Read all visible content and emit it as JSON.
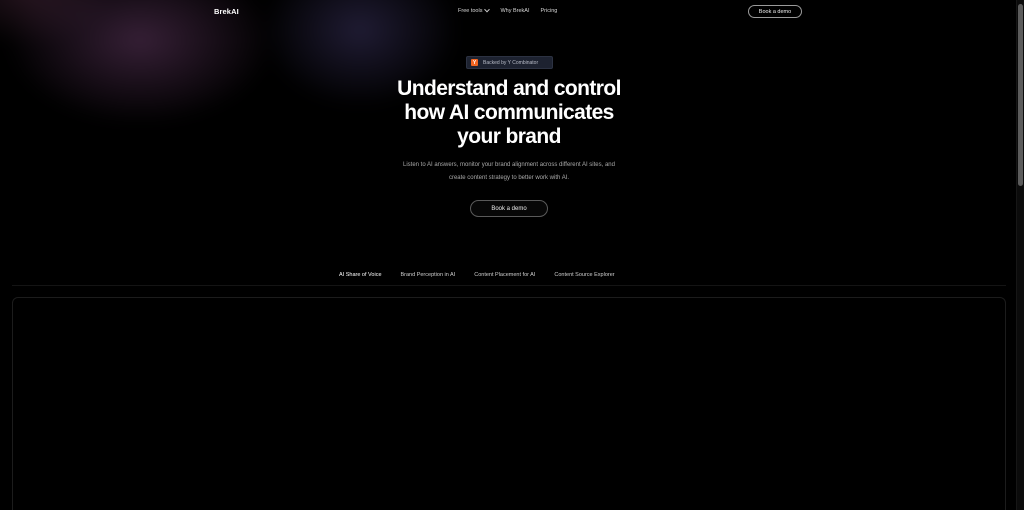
{
  "nav": {
    "brand": "BrekAI",
    "links": [
      "Free tools",
      "Why BrekAI",
      "Pricing"
    ],
    "cta": "Book a demo"
  },
  "hero": {
    "badge_logo": "Y",
    "badge_text": "Backed by Y Combinator",
    "headline_lines": [
      "Understand and control",
      "how AI communicates",
      "your brand"
    ],
    "subtitle_lines": [
      "Listen to AI answers, monitor your brand alignment across different AI sites, and",
      "create content strategy to better work with AI."
    ],
    "cta": "Book a demo"
  },
  "tabs": [
    {
      "label": "AI Share of Voice",
      "active": true
    },
    {
      "label": "Brand Perception in AI",
      "active": false
    },
    {
      "label": "Content Placement for AI",
      "active": false
    },
    {
      "label": "Content Source Explorer",
      "active": false
    }
  ],
  "colors": {
    "background": "#000000",
    "yc_orange": "#f26522",
    "badge_bg": "#1d2230"
  },
  "icons": {
    "free_tools_dropdown": "chevron-down-icon",
    "badge": "ycombinator-logo-icon"
  }
}
